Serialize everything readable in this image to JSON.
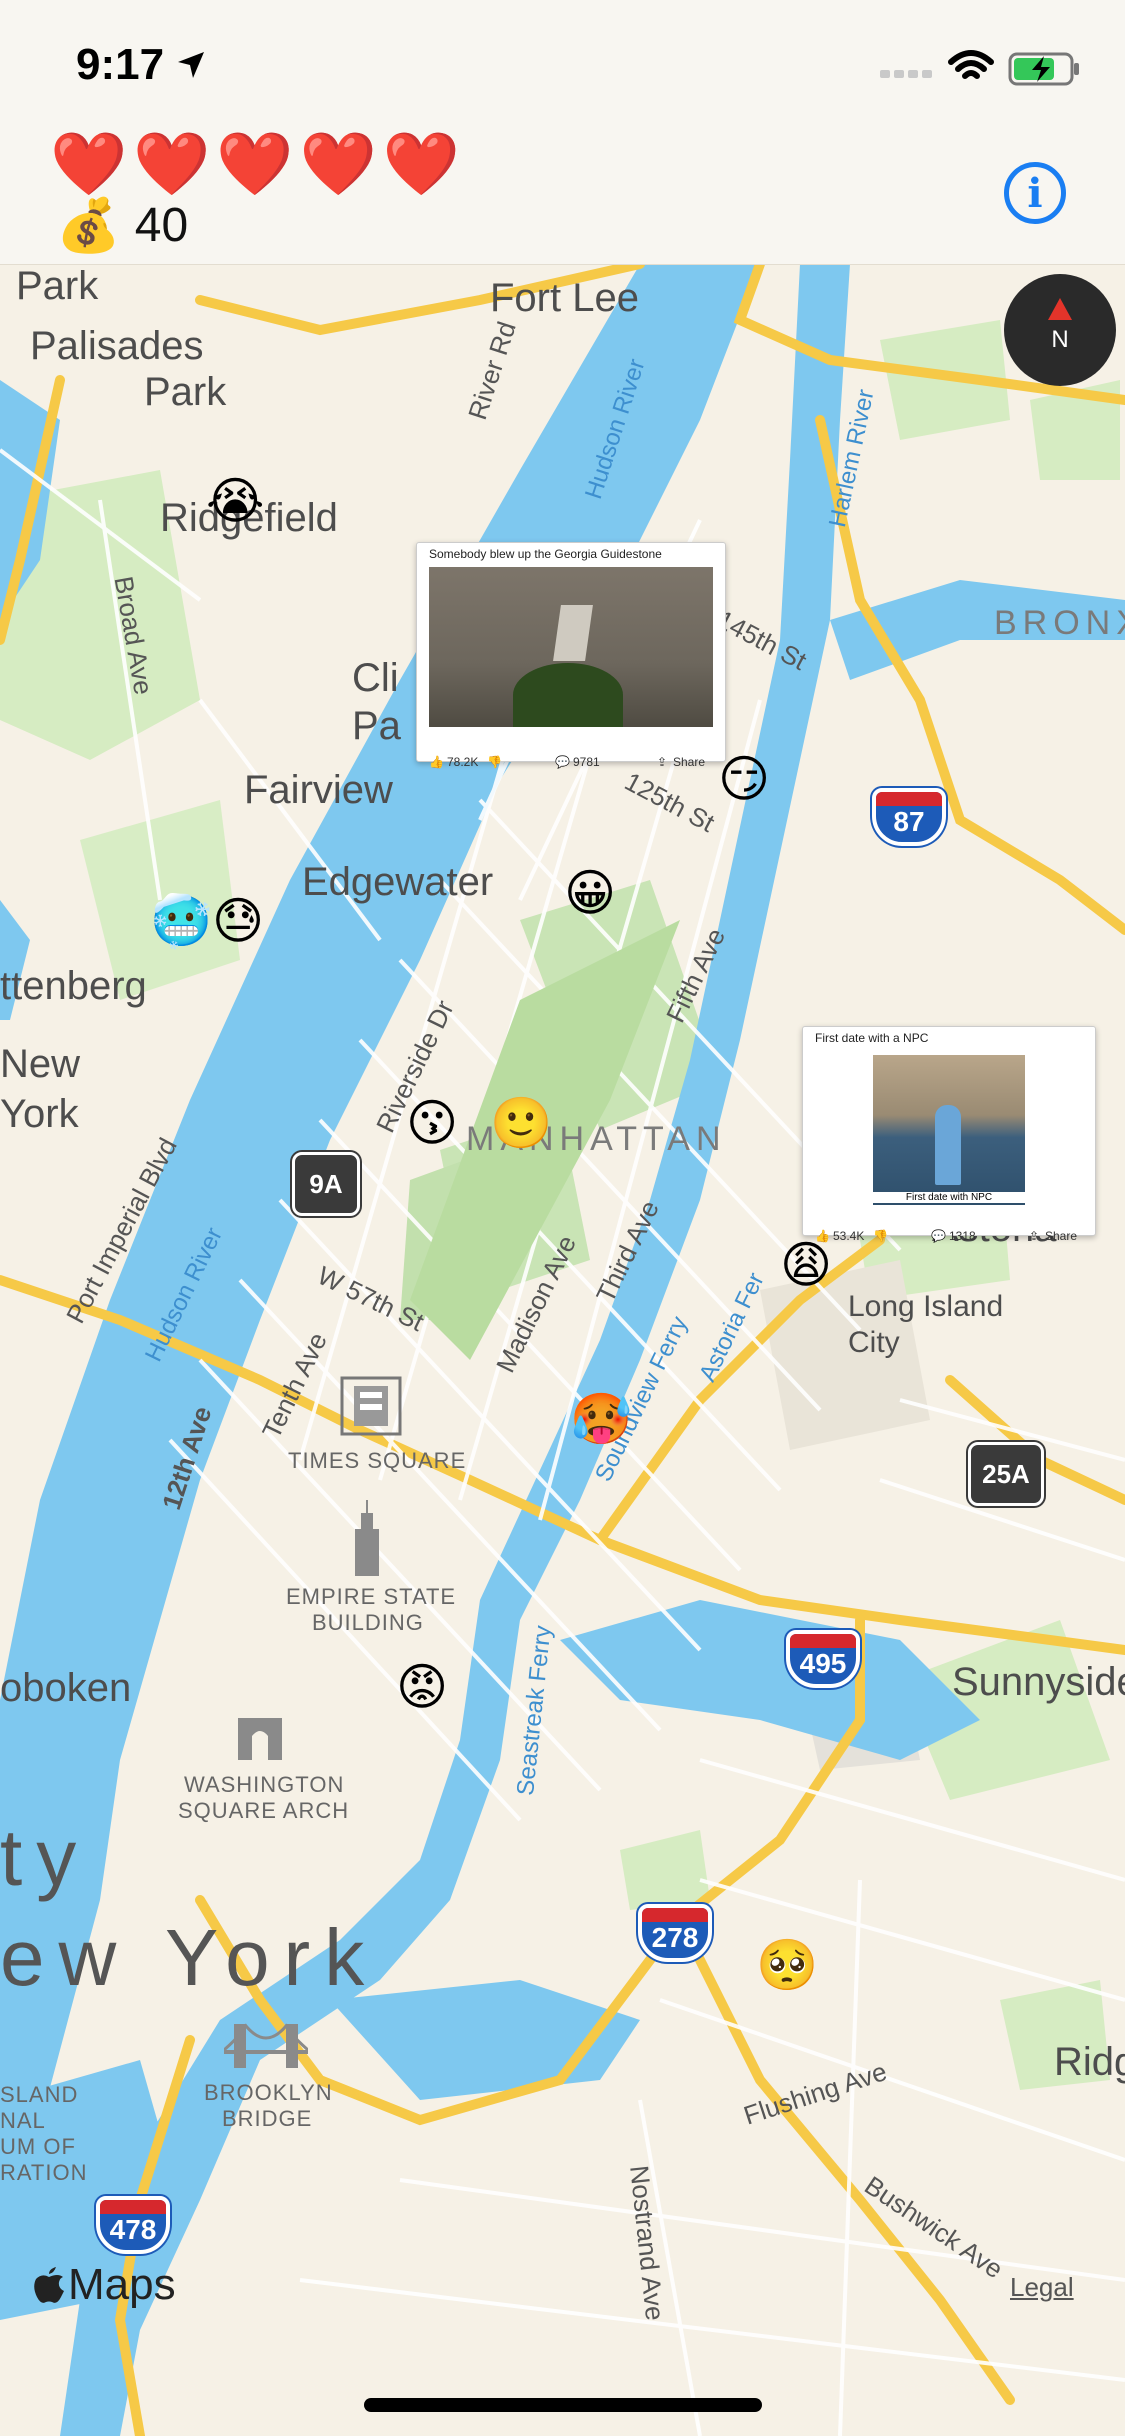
{
  "status_bar": {
    "time": "9:17"
  },
  "header": {
    "hearts": [
      "❤️",
      "❤️",
      "❤️",
      "❤️",
      "❤️"
    ],
    "money_icon": "💰",
    "money_value": "40",
    "info_label": "i"
  },
  "map": {
    "labels": {
      "park": "Park",
      "fort_lee": "Fort Lee",
      "palisades_park_1": "Palisades",
      "palisades_park_2": "Park",
      "ridgefield": "Ridgefield",
      "river_rd": "River Rd",
      "hudson_river_north": "Hudson River",
      "harlem_river": "Harlem River",
      "bronx": "BRONX",
      "broad_ave": "Broad Ave",
      "cliffside_1": "Cli",
      "cliffside_2": "Pa",
      "fairview": "Fairview",
      "st145": "145th St",
      "st125": "125th St",
      "edgewater": "Edgewater",
      "guttenberg": "ttenberg",
      "new_york_west_1": "New",
      "new_york_west_2": "York",
      "port_imperial": "Port Imperial Blvd",
      "riverside_dr": "Riverside Dr",
      "fifth_ave": "Fifth Ave",
      "manhattan": "MANHATTAN",
      "hudson_river_south": "Hudson River",
      "w57": "W 57th St",
      "madison": "Madison Ave",
      "third_ave": "Third Ave",
      "astoria": "Astoria",
      "long_island_1": "Long Island",
      "long_island_2": "City",
      "tenth_ave": "Tenth Ave",
      "twelfth_ave": "12th Ave",
      "soundview": "Soundview Ferry",
      "astoria_ferry": "Astoria Fer",
      "times_square": "TIMES SQUARE",
      "empire_1": "EMPIRE STATE",
      "empire_2": "BUILDING",
      "hoboken": "oboken",
      "sunnyside": "Sunnyside",
      "washington_1": "WASHINGTON",
      "washington_2": "SQUARE ARCH",
      "seastreak": "Seastreak Ferry",
      "ty": "ty",
      "new_york_big": "ew York",
      "ridge": "Ridg",
      "flushing": "Flushing Ave",
      "brooklyn_1": "BROOKLYN",
      "brooklyn_2": "BRIDGE",
      "island_1": "SLAND",
      "island_2": "NAL",
      "island_3": "UM OF",
      "island_4": "RATION",
      "nostrand": "Nostrand Ave",
      "bushwick": "Bushwick Ave"
    },
    "shields": {
      "i87": "87",
      "r9a": "9A",
      "r25a": "25A",
      "i495": "495",
      "i278": "278",
      "i478": "478"
    },
    "emojis": {
      "e1": "😭",
      "e2": "😏",
      "e3": "😀",
      "e4": "🥶",
      "e5": "😓",
      "e6": "😗",
      "e7": "🙂",
      "e8": "😩",
      "e9": "🥵",
      "e10": "😡",
      "e11": "🥺"
    },
    "compass_label": "N",
    "attribution": "Maps",
    "legal": "Legal"
  },
  "posts": [
    {
      "title": "Somebody blew up the Georgia Guidestone",
      "likes": "78.2K",
      "comments": "9781",
      "share": "Share"
    },
    {
      "title": "First date with a NPC",
      "caption": "First date with NPC",
      "likes": "53.4K",
      "comments": "1318",
      "share": "Share"
    }
  ]
}
